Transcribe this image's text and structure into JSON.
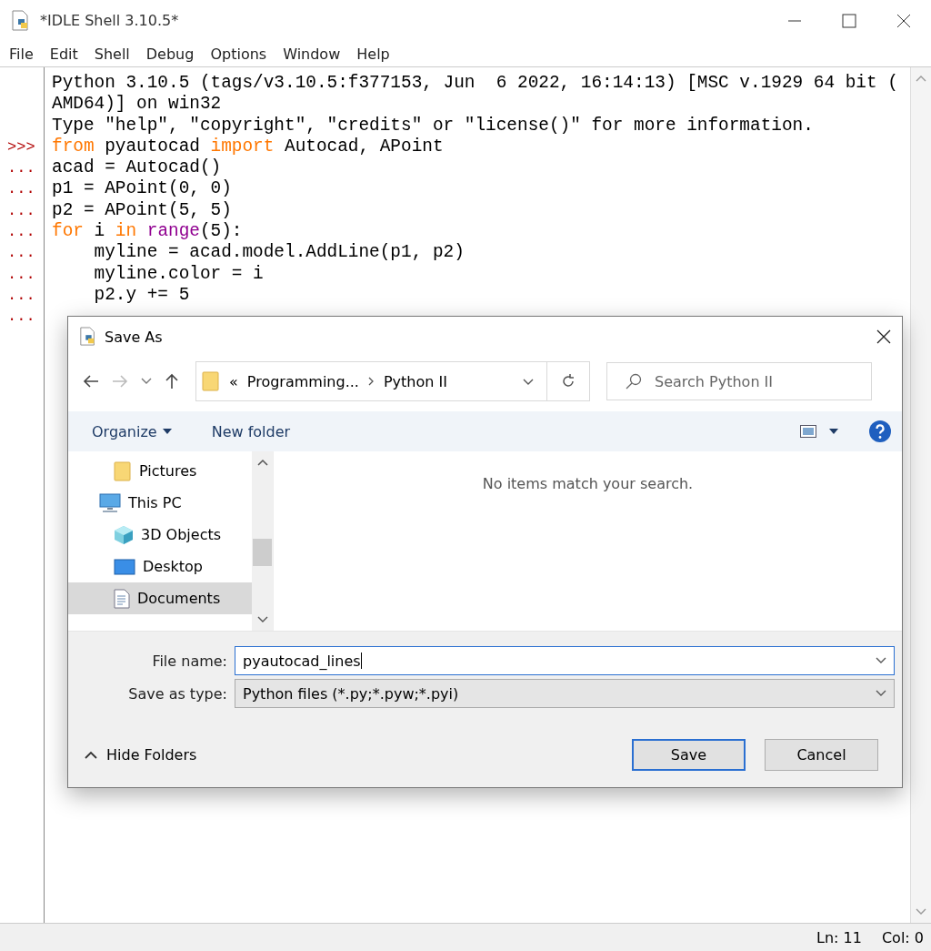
{
  "window": {
    "title": "*IDLE Shell 3.10.5*"
  },
  "menu": [
    "File",
    "Edit",
    "Shell",
    "Debug",
    "Options",
    "Window",
    "Help"
  ],
  "shell_lines": [
    {
      "tokens": [
        {
          "text": "Python 3.10.5 (tags/v3.10.5:f377153, Jun  6 2022, 16:14:13) [MSC v.1929 64 bit (",
          "kind": "plain"
        }
      ]
    },
    {
      "tokens": [
        {
          "text": "AMD64)] on win32",
          "kind": "plain"
        }
      ]
    },
    {
      "tokens": [
        {
          "text": "Type \"help\", \"copyright\", \"credits\" or \"license()\" for more information.",
          "kind": "plain"
        }
      ]
    },
    {
      "prompt": ">>>",
      "tokens": [
        {
          "text": "from",
          "kind": "keyword"
        },
        {
          "text": " pyautocad ",
          "kind": "plain"
        },
        {
          "text": "import",
          "kind": "keyword"
        },
        {
          "text": " Autocad, APoint",
          "kind": "plain"
        }
      ]
    },
    {
      "prompt": "...",
      "tokens": [
        {
          "text": "acad = Autocad()",
          "kind": "plain"
        }
      ]
    },
    {
      "prompt": "...",
      "tokens": [
        {
          "text": "p1 = APoint(0, 0)",
          "kind": "plain"
        }
      ]
    },
    {
      "prompt": "...",
      "tokens": [
        {
          "text": "p2 = APoint(5, 5)",
          "kind": "plain"
        }
      ]
    },
    {
      "prompt": "...",
      "tokens": [
        {
          "text": "for",
          "kind": "keyword"
        },
        {
          "text": " i ",
          "kind": "plain"
        },
        {
          "text": "in ",
          "kind": "keyword"
        },
        {
          "text": "range",
          "kind": "builtin"
        },
        {
          "text": "(5):",
          "kind": "plain"
        }
      ]
    },
    {
      "prompt": "...",
      "tokens": [
        {
          "text": "    myline = acad.model.AddLine(p1, p2)",
          "kind": "plain"
        }
      ]
    },
    {
      "prompt": "...",
      "tokens": [
        {
          "text": "    myline.color = i",
          "kind": "plain"
        }
      ]
    },
    {
      "prompt": "...",
      "tokens": [
        {
          "text": "    p2.y += 5",
          "kind": "plain"
        }
      ]
    },
    {
      "prompt": "..."
    }
  ],
  "status_bar": {
    "line": "Ln: 11",
    "column": "Col: 0"
  },
  "dialog": {
    "title": "Save As",
    "address": {
      "overflow": "«",
      "crumbs": [
        "Programming...",
        "Python II"
      ]
    },
    "search": {
      "placeholder": "Search Python II"
    },
    "toolbar": {
      "organize": "Organize",
      "new_folder": "New folder"
    },
    "tree": [
      {
        "label": "Pictures",
        "kind": "folder",
        "selected": false
      },
      {
        "label": "This PC",
        "kind": "computer",
        "selected": false,
        "children": [
          {
            "label": "3D Objects",
            "kind": "cube",
            "selected": false
          },
          {
            "label": "Desktop",
            "kind": "desktop",
            "selected": false
          },
          {
            "label": "Documents",
            "kind": "document",
            "selected": true
          }
        ]
      }
    ],
    "empty_message": "No items match your search.",
    "file_name": {
      "label": "File name:",
      "value": "pyautocad_lines"
    },
    "file_type": {
      "label": "Save as type:",
      "value": "Python files (*.py;*.pyw;*.pyi)"
    },
    "hide_folders": "Hide Folders",
    "buttons": [
      {
        "label": "Save",
        "default": true
      },
      {
        "label": "Cancel",
        "default": false
      }
    ]
  }
}
